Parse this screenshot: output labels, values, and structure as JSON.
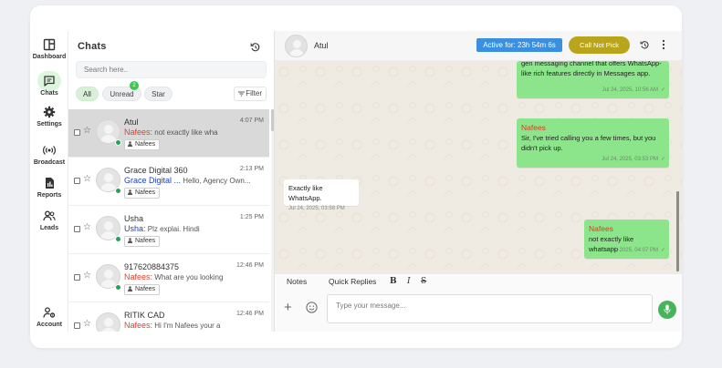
{
  "colors": {
    "brand_green": "#45b45a",
    "selected_row": "#d9d9d9",
    "outgoing_bubble": "#8ce58a",
    "active_badge": "#3a8fe0",
    "call_button": "#b8a51c",
    "sender_red": "#e0402a",
    "sender_blue": "#1f3fc2"
  },
  "nav": {
    "items": [
      {
        "label": "Dashboard",
        "icon": "dashboard-icon"
      },
      {
        "label": "Chats",
        "icon": "chat-icon",
        "active": true
      },
      {
        "label": "Settings",
        "icon": "gear-icon"
      },
      {
        "label": "Broadcast",
        "icon": "broadcast-icon"
      },
      {
        "label": "Reports",
        "icon": "report-icon"
      },
      {
        "label": "Leads",
        "icon": "users-icon"
      }
    ],
    "account_label": "Account"
  },
  "chat_list": {
    "title": "Chats",
    "search_placeholder": "Search here..",
    "filters": {
      "all": "All",
      "unread": "Unread",
      "unread_count": "2",
      "star": "Star"
    },
    "filter_label": "Filter",
    "rows": [
      {
        "name": "Atul",
        "time": "4:07 PM",
        "sender": "Nafees:",
        "preview": "not exactly like wha",
        "tag": "Nafees"
      },
      {
        "name": "Grace Digital 360",
        "time": "2:13 PM",
        "sender": "Grace Digital ...",
        "preview": "Hello, Agency Own...",
        "tag": "Nafees"
      },
      {
        "name": "Usha",
        "time": "1:25 PM",
        "sender": "Usha:",
        "preview": "Plz explai. Hindi",
        "tag": "Nafees"
      },
      {
        "name": "917620884375",
        "time": "12:46 PM",
        "sender": "Nafees:",
        "preview": "What are you looking",
        "tag": "Nafees"
      },
      {
        "name": "RITIK CAD",
        "time": "12:46 PM",
        "sender": "Nafees:",
        "preview": "Hi I'm Nafees your a",
        "tag": ""
      }
    ]
  },
  "chat_header": {
    "contact_name": "Atul",
    "active_for": "Active for: 23h 54m 6s",
    "call_status": "Call Not Pick"
  },
  "messages": [
    {
      "direction": "out",
      "sender": "",
      "text": "gen messaging channel that offers WhatsApp-like rich features directly in Messages app.",
      "time": "Jul 24, 2025, 10:56 AM"
    },
    {
      "direction": "out",
      "sender": "Nafees",
      "text": "Sir, I've tried calling you a few times, but you didn't pick up.",
      "time": "Jul 24, 2025, 03:53 PM"
    },
    {
      "direction": "in",
      "sender": "",
      "text": "Exactly like WhatsApp.",
      "time": "Jul 24, 2025, 03:58 PM"
    },
    {
      "direction": "out",
      "sender": "Nafees",
      "text": "not exactly like whatsapp",
      "time": "Jul 24, 2025, 04:07 PM"
    }
  ],
  "composer": {
    "tab_notes": "Notes",
    "tab_quick": "Quick Replies",
    "bold": "B",
    "italic": "I",
    "strike": "S",
    "placeholder": "Type your message..."
  }
}
